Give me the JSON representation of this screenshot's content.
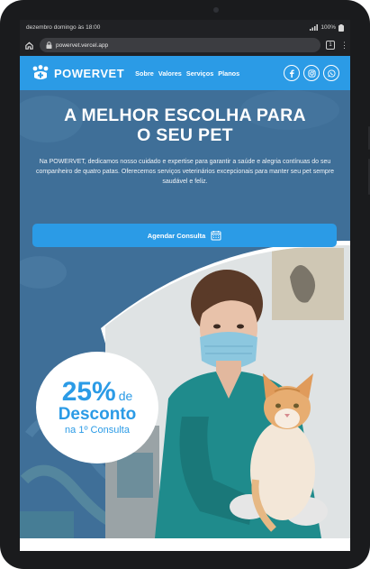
{
  "status": {
    "datetime": "dezembro domingo às 18:00",
    "battery": "100%"
  },
  "browser": {
    "url": "powervet.vercel.app",
    "tab_count": "1"
  },
  "nav": {
    "logo_text": "POWERVET",
    "links": [
      "Sobre",
      "Valores",
      "Serviços",
      "Planos"
    ],
    "socials": [
      "facebook-icon",
      "instagram-icon",
      "whatsapp-icon"
    ]
  },
  "hero": {
    "title_line1": "A MELHOR ESCOLHA PARA",
    "title_line2": "O SEU PET",
    "description": "Na POWERVET, dedicamos nosso cuidado e expertise para garantir a saúde e alegria contínuas do seu companheiro de quatro patas. Oferecemos serviços veterinários excepcionais para manter seu pet sempre saudável e feliz.",
    "cta_label": "Agendar Consulta",
    "cta_icon": "calendar-icon"
  },
  "promo": {
    "percent": "25%",
    "de": "de",
    "desconto": "Desconto",
    "sub": "na 1º Consulta"
  },
  "colors": {
    "brand_blue": "#2b9be6",
    "overlay_blue": "#3f6f98"
  }
}
